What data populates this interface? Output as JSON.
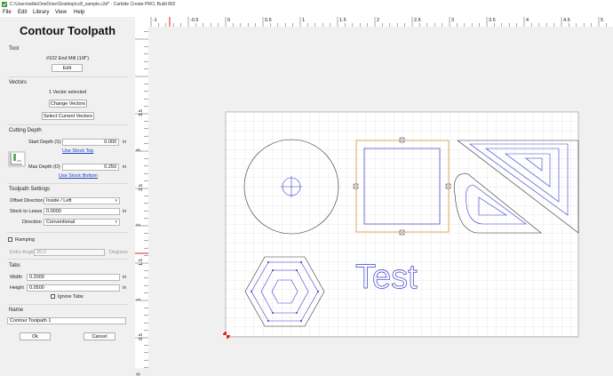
{
  "window": {
    "title": "C:\\Users\\willa\\OneDrive\\Desktop\\cc8_sample.c2d* - Carbide Create PRO, Build 802"
  },
  "menu": [
    "File",
    "Edit",
    "Library",
    "View",
    "Help"
  ],
  "panel": {
    "title": "Contour Toolpath",
    "tool": {
      "heading": "Tool",
      "name": "#102 End Mill (1/8\")",
      "edit_label": "Edit"
    },
    "vectors": {
      "heading": "Vectors",
      "count_text": "1 Vector selected",
      "change_label": "Change Vectors",
      "select_label": "Select Current Vectors"
    },
    "cutting_depth": {
      "heading": "Cutting Depth",
      "start_label": "Start Depth (S)",
      "start_value": "0.000",
      "start_unit": "in",
      "use_stock_top": "Use Stock Top",
      "max_label": "Max Depth (D)",
      "max_value": "0.250",
      "max_unit": "in",
      "use_stock_bottom": "Use Stock Bottom"
    },
    "toolpath_settings": {
      "heading": "Toolpath Settings",
      "offset_label": "Offset Direction",
      "offset_value": "Inside / Left",
      "stock_label": "Stock to Leave",
      "stock_value": "0.0000",
      "stock_unit": "in",
      "direction_label": "Direction",
      "direction_value": "Conventional"
    },
    "ramping": {
      "label": "Ramping",
      "entry_label": "Entry Angle",
      "entry_value": "20.0",
      "entry_unit": "Degrees"
    },
    "tabs": {
      "heading": "Tabs",
      "width_label": "Width",
      "width_value": "0.2000",
      "width_unit": "in",
      "height_label": "Height",
      "height_value": "0.0500",
      "height_unit": "in",
      "ignore_label": "Ignore Tabs"
    },
    "name": {
      "heading": "Name",
      "value": "Contour Toolpath 1"
    },
    "ok_label": "Ok",
    "cancel_label": "Cancel"
  },
  "ruler": {
    "top": [
      "-1",
      "-0.5",
      "0",
      "0.5",
      "1",
      "1.5",
      "2",
      "2.5",
      "3",
      "3.5",
      "4",
      "4.5",
      "5"
    ],
    "left": [
      "3.5",
      "3",
      "2.5",
      "2",
      "1.5",
      "1",
      "0.5",
      "0"
    ]
  },
  "canvas": {
    "text_label": "Test"
  },
  "colors": {
    "vector": "#3a3ad0",
    "selection": "#e08020",
    "origin": "#dd2222",
    "outline": "#333333"
  }
}
